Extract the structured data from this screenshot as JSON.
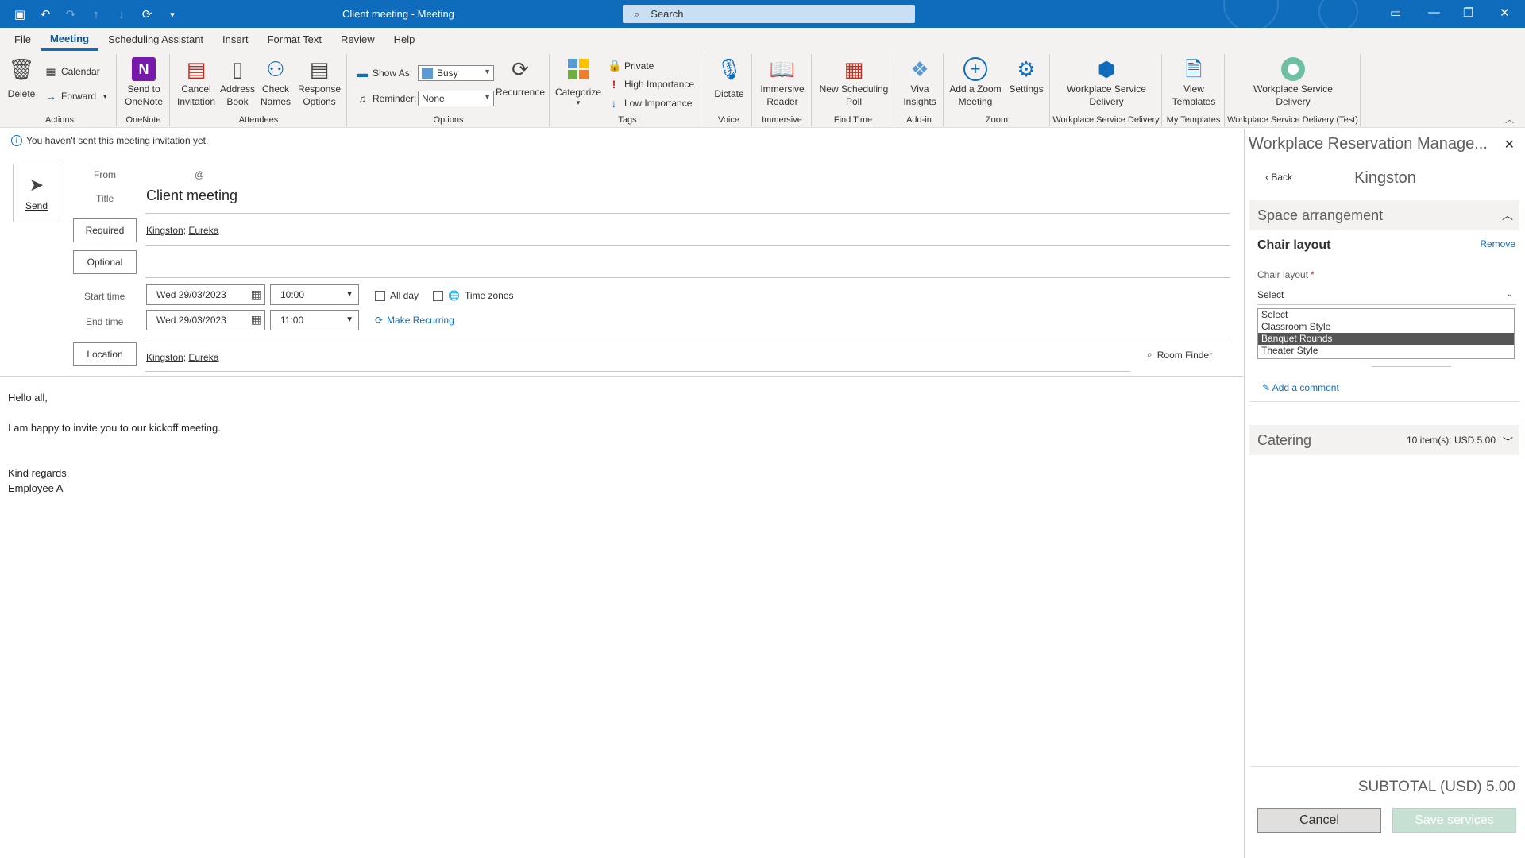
{
  "window": {
    "title": "Client meeting  -  Meeting",
    "search_placeholder": "Search"
  },
  "tabs": [
    "File",
    "Meeting",
    "Scheduling Assistant",
    "Insert",
    "Format Text",
    "Review",
    "Help"
  ],
  "ribbon": {
    "actions": {
      "delete": "Delete",
      "calendar": "Calendar",
      "forward": "Forward",
      "label": "Actions"
    },
    "onenote": {
      "send": "Send to OneNote",
      "label": "OneNote"
    },
    "attendees": {
      "cancel": "Cancel Invitation",
      "address": "Address Book",
      "check": "Check Names",
      "response": "Response Options",
      "label": "Attendees"
    },
    "options": {
      "show_as_label": "Show As:",
      "show_as_value": "Busy",
      "reminder_label": "Reminder:",
      "reminder_value": "None",
      "recurrence": "Recurrence",
      "label": "Options"
    },
    "tags": {
      "categorize": "Categorize",
      "private": "Private",
      "high": "High Importance",
      "low": "Low Importance",
      "label": "Tags"
    },
    "voice": {
      "dictate": "Dictate",
      "label": "Voice"
    },
    "immersive": {
      "reader": "Immersive Reader",
      "label": "Immersive"
    },
    "findtime": {
      "poll": "New Scheduling Poll",
      "label": "Find Time"
    },
    "addin": {
      "viva": "Viva Insights",
      "label": "Add-in"
    },
    "zoom": {
      "add": "Add a Zoom Meeting",
      "settings": "Settings",
      "label": "Zoom"
    },
    "wsd": {
      "btn": "Workplace Service Delivery",
      "label": "Workplace Service Delivery"
    },
    "templates": {
      "view": "View Templates",
      "label": "My Templates"
    },
    "wsd_test": {
      "btn": "Workplace Service Delivery",
      "label": "Workplace Service Delivery (Test)"
    }
  },
  "compose": {
    "info": "You haven't sent this meeting invitation yet.",
    "send": "Send",
    "from_label": "From",
    "from_value": "@",
    "title_label": "Title",
    "title_value": "Client meeting",
    "required_btn": "Required",
    "required_recipients": [
      "Kingston",
      "Eureka"
    ],
    "optional_btn": "Optional",
    "start_label": "Start time",
    "start_date": "Wed 29/03/2023",
    "start_time": "10:00",
    "end_label": "End time",
    "end_date": "Wed 29/03/2023",
    "end_time": "11:00",
    "all_day": "All day",
    "time_zones": "Time zones",
    "make_recurring": "Make Recurring",
    "location_btn": "Location",
    "location_recipients": [
      "Kingston",
      "Eureka"
    ],
    "room_finder": "Room Finder",
    "body": [
      "Hello all,",
      "",
      "I am happy to invite you to our kickoff meeting.",
      "",
      "",
      "Kind regards,",
      "Employee A"
    ]
  },
  "pane": {
    "title": "Workplace Reservation Manage...",
    "back": "Back",
    "subtitle": "Kingston",
    "space_arrangement": "Space arrangement",
    "chair_layout_title": "Chair layout",
    "remove": "Remove",
    "chair_layout_label": "Chair layout",
    "select_value": "Select",
    "options": [
      "Select",
      "Classroom Style",
      "Banquet Rounds",
      "Theater Style"
    ],
    "selected_option": "Banquet Rounds",
    "add_comment": "Add a comment",
    "catering": "Catering",
    "catering_meta": "10 item(s):  USD 5.00",
    "subtotal": "SUBTOTAL (USD) 5.00",
    "cancel": "Cancel",
    "save": "Save services"
  },
  "colors": {
    "accent": "#0f6cbd",
    "titlebar": "#0f6cbd",
    "save_disabled": "#c7e0d4",
    "highlight": "#555555"
  }
}
